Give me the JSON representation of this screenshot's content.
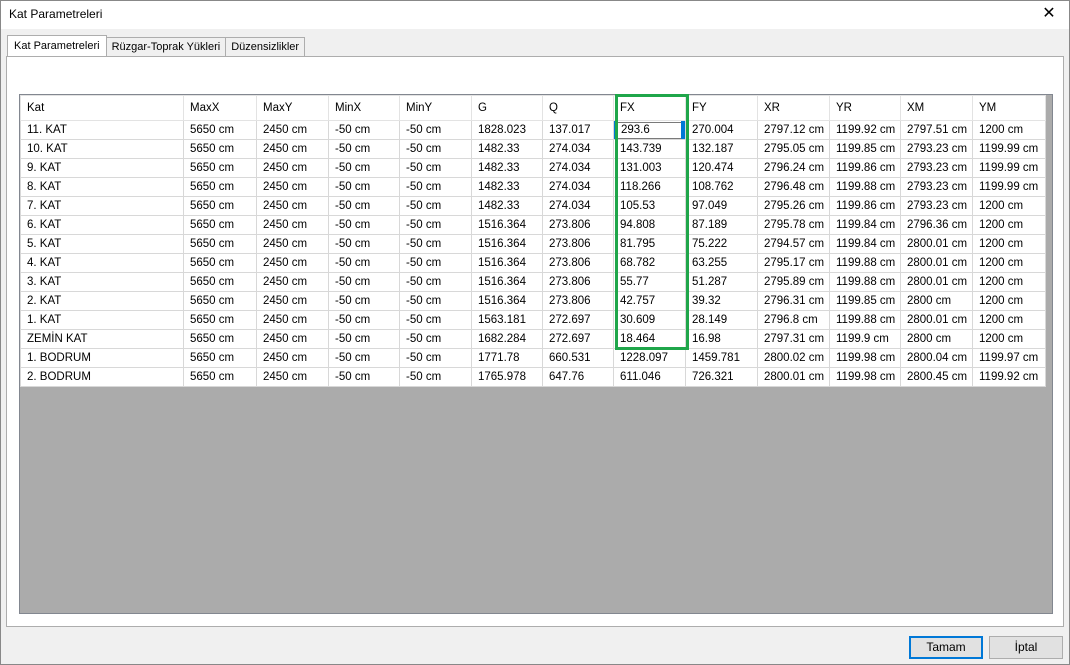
{
  "window": {
    "title": "Kat Parametreleri"
  },
  "tabs": [
    {
      "label": "Kat Parametreleri",
      "active": true
    },
    {
      "label": "Rüzgar-Toprak Yükleri",
      "active": false
    },
    {
      "label": "Düzensizlikler",
      "active": false
    }
  ],
  "grid": {
    "columns": [
      "Kat",
      "MaxX",
      "MaxY",
      "MinX",
      "MinY",
      "G",
      "Q",
      "FX",
      "FY",
      "XR",
      "YR",
      "XM",
      "YM"
    ],
    "rows": [
      [
        "11. KAT",
        "5650 cm",
        "2450 cm",
        "-50 cm",
        "-50 cm",
        "1828.023",
        "137.017",
        "293.6",
        "270.004",
        "2797.12 cm",
        "1199.92 cm",
        "2797.51 cm",
        "1200 cm"
      ],
      [
        "10. KAT",
        "5650 cm",
        "2450 cm",
        "-50 cm",
        "-50 cm",
        "1482.33",
        "274.034",
        "143.739",
        "132.187",
        "2795.05 cm",
        "1199.85 cm",
        "2793.23 cm",
        "1199.99 cm"
      ],
      [
        "9. KAT",
        "5650 cm",
        "2450 cm",
        "-50 cm",
        "-50 cm",
        "1482.33",
        "274.034",
        "131.003",
        "120.474",
        "2796.24 cm",
        "1199.86 cm",
        "2793.23 cm",
        "1199.99 cm"
      ],
      [
        "8. KAT",
        "5650 cm",
        "2450 cm",
        "-50 cm",
        "-50 cm",
        "1482.33",
        "274.034",
        "118.266",
        "108.762",
        "2796.48 cm",
        "1199.88 cm",
        "2793.23 cm",
        "1199.99 cm"
      ],
      [
        "7. KAT",
        "5650 cm",
        "2450 cm",
        "-50 cm",
        "-50 cm",
        "1482.33",
        "274.034",
        "105.53",
        "97.049",
        "2795.26 cm",
        "1199.86 cm",
        "2793.23 cm",
        "1200 cm"
      ],
      [
        "6. KAT",
        "5650 cm",
        "2450 cm",
        "-50 cm",
        "-50 cm",
        "1516.364",
        "273.806",
        "94.808",
        "87.189",
        "2795.78 cm",
        "1199.84 cm",
        "2796.36 cm",
        "1200 cm"
      ],
      [
        "5. KAT",
        "5650 cm",
        "2450 cm",
        "-50 cm",
        "-50 cm",
        "1516.364",
        "273.806",
        "81.795",
        "75.222",
        "2794.57 cm",
        "1199.84 cm",
        "2800.01 cm",
        "1200 cm"
      ],
      [
        "4. KAT",
        "5650 cm",
        "2450 cm",
        "-50 cm",
        "-50 cm",
        "1516.364",
        "273.806",
        "68.782",
        "63.255",
        "2795.17 cm",
        "1199.88 cm",
        "2800.01 cm",
        "1200 cm"
      ],
      [
        "3. KAT",
        "5650 cm",
        "2450 cm",
        "-50 cm",
        "-50 cm",
        "1516.364",
        "273.806",
        "55.77",
        "51.287",
        "2795.89 cm",
        "1199.88 cm",
        "2800.01 cm",
        "1200 cm"
      ],
      [
        "2. KAT",
        "5650 cm",
        "2450 cm",
        "-50 cm",
        "-50 cm",
        "1516.364",
        "273.806",
        "42.757",
        "39.32",
        "2796.31 cm",
        "1199.85 cm",
        "2800 cm",
        "1200 cm"
      ],
      [
        "1. KAT",
        "5650 cm",
        "2450 cm",
        "-50 cm",
        "-50 cm",
        "1563.181",
        "272.697",
        "30.609",
        "28.149",
        "2796.8 cm",
        "1199.88 cm",
        "2800.01 cm",
        "1200 cm"
      ],
      [
        "ZEMİN KAT",
        "5650 cm",
        "2450 cm",
        "-50 cm",
        "-50 cm",
        "1682.284",
        "272.697",
        "18.464",
        "16.98",
        "2797.31 cm",
        "1199.9 cm",
        "2800 cm",
        "1200 cm"
      ],
      [
        "1. BODRUM",
        "5650 cm",
        "2450 cm",
        "-50 cm",
        "-50 cm",
        "1771.78",
        "660.531",
        "1228.097",
        "1459.781",
        "2800.02 cm",
        "1199.98 cm",
        "2800.04 cm",
        "1199.97 cm"
      ],
      [
        "2. BODRUM",
        "5650 cm",
        "2450 cm",
        "-50 cm",
        "-50 cm",
        "1765.978",
        "647.76",
        "611.046",
        "726.321",
        "2800.01 cm",
        "1199.98 cm",
        "2800.45 cm",
        "1199.92 cm"
      ]
    ]
  },
  "buttons": {
    "ok": "Tamam",
    "cancel": "İptal"
  },
  "colors": {
    "highlight": "#1fa64a",
    "focus": "#0078d7"
  }
}
